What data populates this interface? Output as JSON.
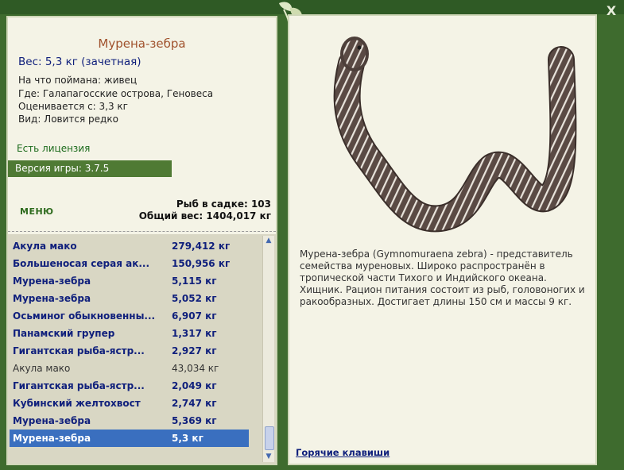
{
  "window": {
    "close_label": "X"
  },
  "fish": {
    "title": "Мурена-зебра",
    "weight": "Вес: 5,3 кг (зачетная)",
    "caught_on": "На что поймана: живец",
    "where": "Где: Галапагосские острова, Геновеса",
    "valued_from": "Оценивается с: 3,3 кг",
    "rarity": "Вид: Ловится редко",
    "license": "Есть лицензия",
    "description": "Мурена-зебра (Gymnomuraena zebra) - представитель семейства муреновых. Широко распространён в тропической части Тихого и Индийского океана. Хищник. Рацион питания состоит из рыб, головоногих и ракообразных. Достигает длины 150 см и массы 9 кг."
  },
  "version": "Версия игры: 3.7.5",
  "menu_label": "МЕНЮ",
  "stats": {
    "fish_in_cage": "Рыб в садке: 103",
    "total_weight": "Общий вес: 1404,017 кг"
  },
  "catch_list": [
    {
      "name": "Акула мако",
      "weight": "279,412 кг",
      "style": "bold"
    },
    {
      "name": "Большеносая серая ак...",
      "weight": "150,956 кг",
      "style": "bold"
    },
    {
      "name": "Мурена-зебра",
      "weight": "5,115 кг",
      "style": "bold"
    },
    {
      "name": "Мурена-зебра",
      "weight": "5,052 кг",
      "style": "bold"
    },
    {
      "name": "Осьминог обыкновенны...",
      "weight": "6,907 кг",
      "style": "bold"
    },
    {
      "name": "Панамский групер",
      "weight": "1,317 кг",
      "style": "bold"
    },
    {
      "name": "Гигантская рыба-ястр...",
      "weight": "2,927 кг",
      "style": "bold"
    },
    {
      "name": "Акула мако",
      "weight": "43,034 кг",
      "style": "plain"
    },
    {
      "name": "Гигантская рыба-ястр...",
      "weight": "2,049 кг",
      "style": "bold"
    },
    {
      "name": "Кубинский желтохвост",
      "weight": "2,747 кг",
      "style": "bold"
    },
    {
      "name": "Мурена-зебра",
      "weight": "5,369 кг",
      "style": "bold"
    },
    {
      "name": "Мурена-зебра",
      "weight": "5,3 кг",
      "style": "selected"
    }
  ],
  "hotkeys_label": "Горячие клавиши",
  "colors": {
    "frame": "#3e6b2e",
    "panel": "#f4f3e6",
    "title": "#a0522d",
    "navy": "#10207c",
    "selection": "#3a6fbf",
    "version_bar": "#4f7a34"
  },
  "icons": {
    "close": "close-icon",
    "leaf": "leaf-decoration-icon",
    "scroll_up": "scroll-up-arrow-icon",
    "scroll_down": "scroll-down-arrow-icon"
  }
}
